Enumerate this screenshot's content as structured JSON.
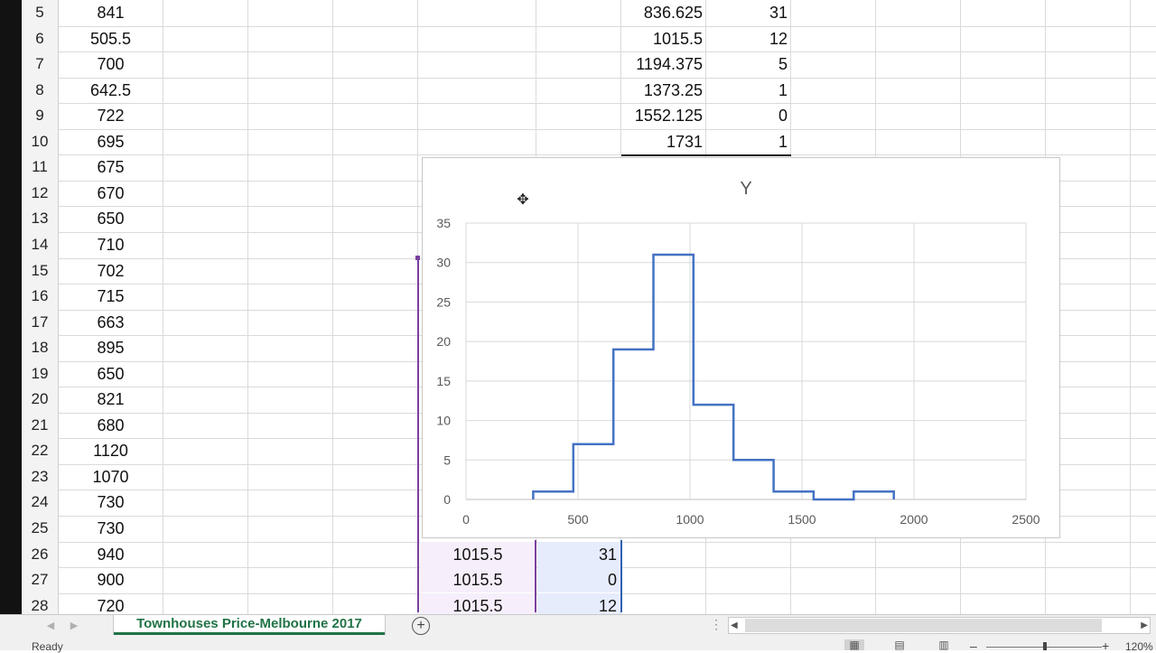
{
  "row_numbers": [
    "5",
    "6",
    "7",
    "8",
    "9",
    "10",
    "11",
    "12",
    "13",
    "14",
    "15",
    "16",
    "17",
    "18",
    "19",
    "20",
    "21",
    "22",
    "23",
    "24",
    "25",
    "26",
    "27",
    "28"
  ],
  "column_a_values": [
    "841",
    "505.5",
    "700",
    "642.5",
    "722",
    "695",
    "675",
    "670",
    "650",
    "710",
    "702",
    "715",
    "663",
    "895",
    "650",
    "821",
    "680",
    "1120",
    "1070",
    "730",
    "730",
    "940",
    "900",
    "720"
  ],
  "frequency_table": [
    {
      "bin": "836.625",
      "count": "31"
    },
    {
      "bin": "1015.5",
      "count": "12"
    },
    {
      "bin": "1194.375",
      "count": "5"
    },
    {
      "bin": "1373.25",
      "count": "1"
    },
    {
      "bin": "1552.125",
      "count": "0"
    },
    {
      "bin": "1731",
      "count": "1"
    }
  ],
  "lower_table": [
    {
      "x": "1015.5",
      "y": "31"
    },
    {
      "x": "1015.5",
      "y": "0"
    },
    {
      "x": "1015.5",
      "y": "12"
    }
  ],
  "chart_data": {
    "type": "line",
    "title": "Y",
    "xlabel": "",
    "ylabel": "",
    "xlim": [
      0,
      2500
    ],
    "ylim": [
      0,
      35
    ],
    "x_ticks": [
      "0",
      "500",
      "1000",
      "1500",
      "2000",
      "2500"
    ],
    "y_ticks": [
      "0",
      "5",
      "10",
      "15",
      "20",
      "25",
      "30",
      "35"
    ],
    "grid": true,
    "legend": "none",
    "series_color": "#4472c4",
    "series": [
      {
        "x": [
          300,
          300,
          479,
          479,
          658,
          658,
          836.625,
          836.625,
          1015.5,
          1015.5,
          1194.375,
          1194.375,
          1373.25,
          1373.25,
          1552.125,
          1552.125,
          1731,
          1731,
          1910,
          1910
        ],
        "y": [
          0,
          1,
          1,
          7,
          7,
          19,
          19,
          31,
          31,
          12,
          12,
          5,
          5,
          1,
          1,
          0,
          0,
          1,
          1,
          0
        ]
      }
    ]
  },
  "sheet_tab": "Townhouses Price-Melbourne 2017",
  "status": "Ready",
  "zoom_label": "120%",
  "icons": {
    "move": "move-cursor-icon",
    "add": "add-sheet-icon"
  }
}
